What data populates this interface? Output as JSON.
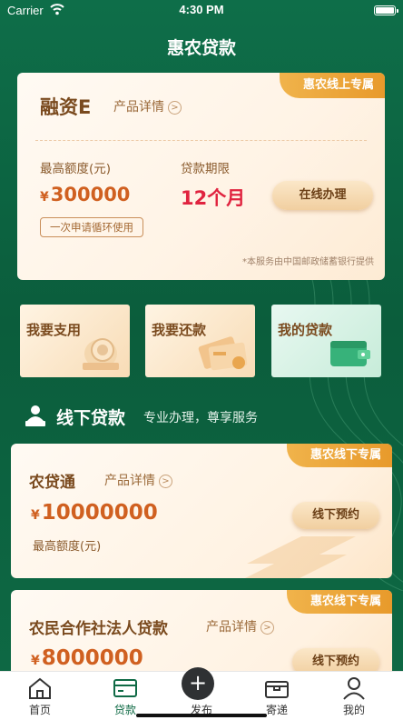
{
  "status_bar": {
    "carrier": "Carrier",
    "time": "4:30 PM"
  },
  "nav": {
    "title": "惠农贷款"
  },
  "online_loan": {
    "ribbon": "惠农线上专属",
    "product_name": "融资E",
    "detail_link": "产品详情",
    "limit_label": "最高额度(元)",
    "limit_value": "300000",
    "currency": "¥",
    "term_label": "贷款期限",
    "term_value": "12个月",
    "apply_button": "在线办理",
    "cycle_tag": "一次申请循环使用",
    "footnote": "*本服务由中国邮政储蓄银行提供"
  },
  "quick_tiles": [
    {
      "label": "我要支用"
    },
    {
      "label": "我要还款"
    },
    {
      "label": "我的贷款"
    }
  ],
  "offline_section": {
    "title": "线下贷款",
    "subtitle": "专业办理，尊享服务"
  },
  "offline_loans": [
    {
      "ribbon": "惠农线下专属",
      "product_name": "农贷通",
      "detail_link": "产品详情",
      "currency": "¥",
      "amount": "10000000",
      "limit_label": "最高额度(元)",
      "button": "线下预约"
    },
    {
      "ribbon": "惠农线下专属",
      "product_name": "农民合作社法人贷款",
      "detail_link": "产品详情",
      "currency": "¥",
      "amount": "8000000",
      "button": "线下预约"
    }
  ],
  "tabbar": {
    "items": [
      {
        "label": "首页",
        "icon": "home-icon"
      },
      {
        "label": "贷款",
        "icon": "wallet-icon"
      },
      {
        "label": "发布",
        "icon": "plus-icon"
      },
      {
        "label": "寄递",
        "icon": "parcel-icon"
      },
      {
        "label": "我的",
        "icon": "person-icon"
      }
    ],
    "active_index": 1,
    "active_color": "#0f6a45"
  },
  "colors": {
    "brand_green": "#0f6a45",
    "accent_orange": "#e89a2b",
    "amount_orange": "#d06020",
    "term_red": "#e0233f"
  }
}
